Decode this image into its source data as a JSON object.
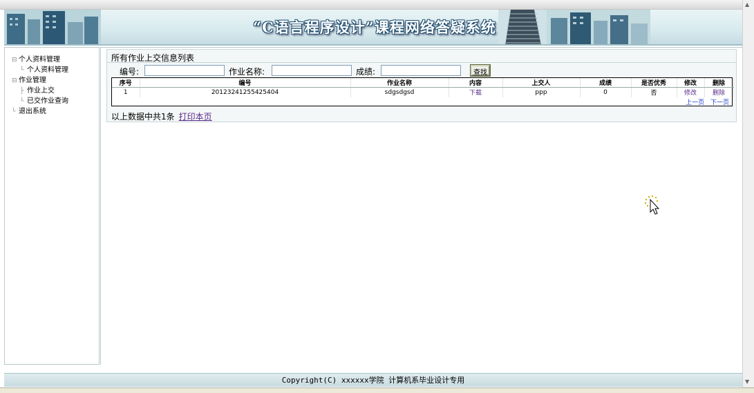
{
  "banner": {
    "title": "“C语言程序设计”课程网络答疑系统"
  },
  "sidebar": {
    "groups": [
      {
        "label": "个人资料管理",
        "items": [
          {
            "label": "个人资料管理"
          }
        ]
      },
      {
        "label": "作业管理",
        "items": [
          {
            "label": "作业上交"
          },
          {
            "label": "已交作业查询"
          }
        ]
      },
      {
        "label": "退出系统",
        "items": []
      }
    ]
  },
  "main": {
    "panel_title": "所有作业上交信息列表",
    "search": {
      "number_label": "编号:",
      "number_value": "",
      "name_label": "作业名称:",
      "name_value": "",
      "score_label": "成绩:",
      "score_value": "",
      "find_button": "查找"
    },
    "table": {
      "headers": [
        "序号",
        "编号",
        "作业名称",
        "内容",
        "上交人",
        "成绩",
        "是否优秀",
        "修改",
        "删除"
      ],
      "rows": [
        {
          "index": "1",
          "number": "20123241255425404",
          "name": "sdgsdgsd",
          "content": "下载",
          "submitter": "ppp",
          "score": "0",
          "excellent": "否",
          "edit": "修改",
          "delete": "删除"
        }
      ]
    },
    "pager": {
      "prev": "上一页",
      "next": "下一页"
    },
    "summary": {
      "text": "以上数据中共1条",
      "print_link": "打印本页"
    }
  },
  "footer": {
    "copyright": "Copyright(C) xxxxxx学院 计算机系毕业设计专用"
  },
  "colors": {
    "banner_bg": "#d7eaee",
    "link_visited": "#5b2b8a",
    "link": "#1a3fc7",
    "panel_bg": "#f4f7f7"
  }
}
